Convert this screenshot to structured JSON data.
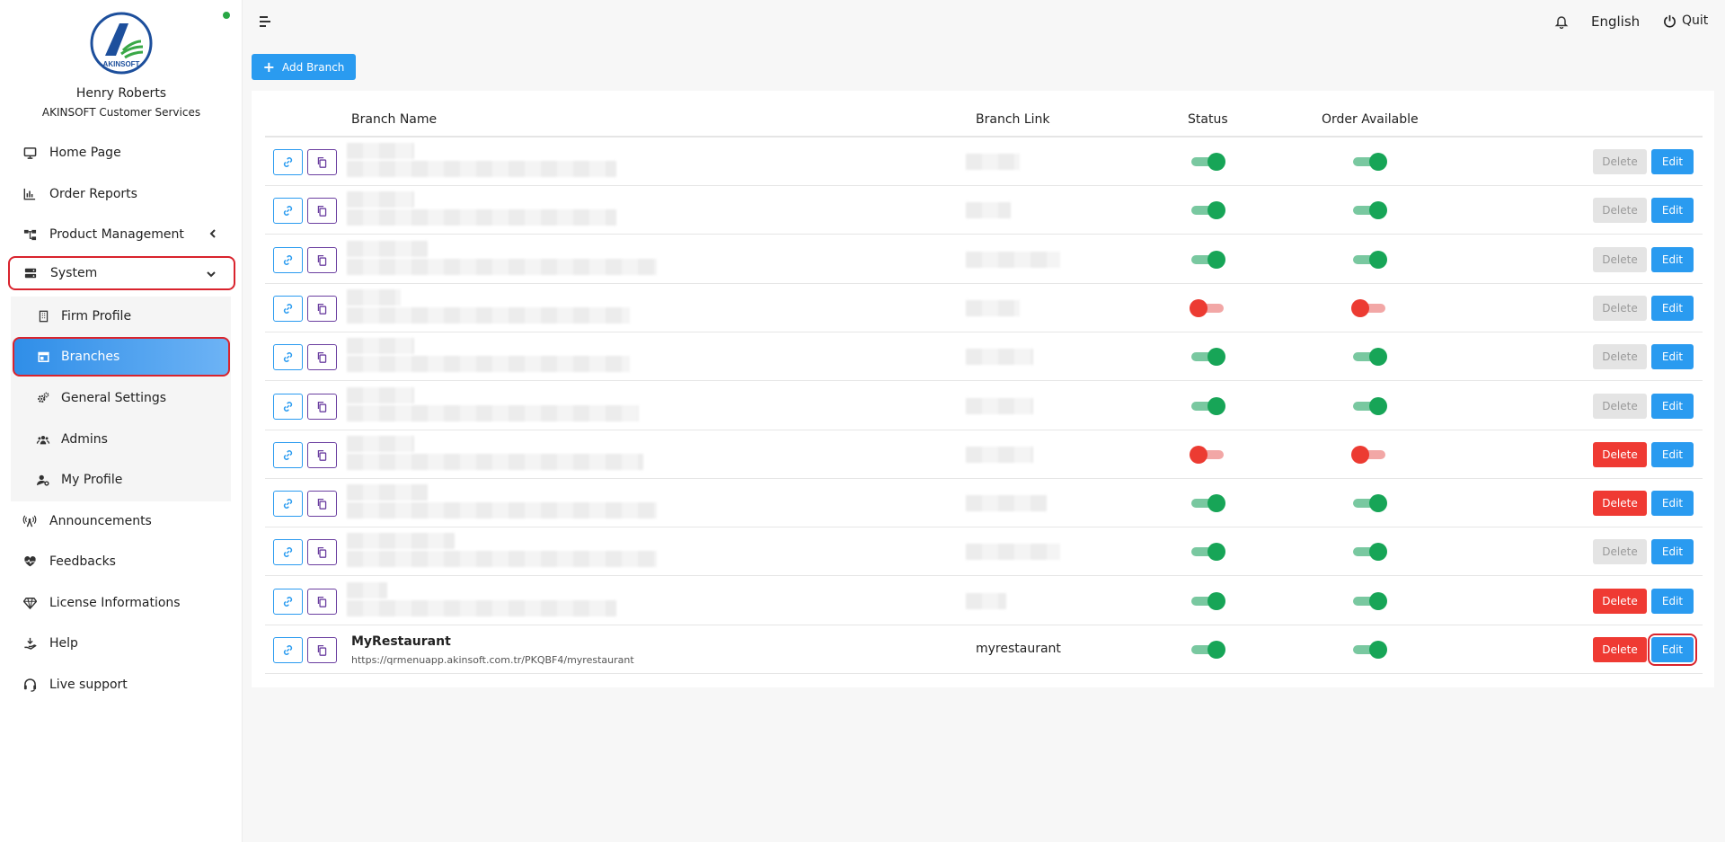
{
  "app": {
    "logo_text": "AKINSOFT"
  },
  "user": {
    "name": "Henry Roberts",
    "role": "AKINSOFT Customer Services"
  },
  "sidebar": {
    "items": [
      {
        "label": "Home Page",
        "icon": "monitor-icon"
      },
      {
        "label": "Order Reports",
        "icon": "bar-chart-icon"
      },
      {
        "label": "Product Management",
        "icon": "sitemap-icon"
      },
      {
        "label": "System",
        "icon": "server-icon"
      },
      {
        "label": "Announcements",
        "icon": "broadcast-icon"
      },
      {
        "label": "Feedbacks",
        "icon": "heart-pulse-icon"
      },
      {
        "label": "License Informations",
        "icon": "gem-icon"
      },
      {
        "label": "Help",
        "icon": "hand-holding-icon"
      },
      {
        "label": "Live support",
        "icon": "headset-icon"
      }
    ],
    "system_submenu": [
      {
        "label": "Firm Profile",
        "icon": "building-icon"
      },
      {
        "label": "Branches",
        "icon": "store-icon"
      },
      {
        "label": "General Settings",
        "icon": "gears-icon"
      },
      {
        "label": "Admins",
        "icon": "users-icon"
      },
      {
        "label": "My Profile",
        "icon": "user-gear-icon"
      }
    ]
  },
  "topbar": {
    "language": "English",
    "quit_label": "Quit"
  },
  "toolbar": {
    "add_branch_label": "Add Branch"
  },
  "table": {
    "columns": [
      "Branch Name",
      "Branch Link",
      "Status",
      "Order Available"
    ],
    "delete_label": "Delete",
    "edit_label": "Edit",
    "rows": [
      {
        "name": "",
        "url": "",
        "link": "",
        "status": true,
        "order_available": true,
        "delete_enabled": false
      },
      {
        "name": "",
        "url": "",
        "link": "",
        "status": true,
        "order_available": true,
        "delete_enabled": false
      },
      {
        "name": "",
        "url": "",
        "link": "",
        "status": true,
        "order_available": true,
        "delete_enabled": false
      },
      {
        "name": "",
        "url": "",
        "link": "",
        "status": false,
        "order_available": false,
        "delete_enabled": false
      },
      {
        "name": "",
        "url": "",
        "link": "",
        "status": true,
        "order_available": true,
        "delete_enabled": false
      },
      {
        "name": "",
        "url": "",
        "link": "",
        "status": true,
        "order_available": true,
        "delete_enabled": false
      },
      {
        "name": "",
        "url": "",
        "link": "",
        "status": false,
        "order_available": false,
        "delete_enabled": true
      },
      {
        "name": "",
        "url": "",
        "link": "",
        "status": true,
        "order_available": true,
        "delete_enabled": true
      },
      {
        "name": "",
        "url": "",
        "link": "",
        "status": true,
        "order_available": true,
        "delete_enabled": false
      },
      {
        "name": "",
        "url": "",
        "link": "",
        "status": true,
        "order_available": true,
        "delete_enabled": true
      },
      {
        "name": "MyRestaurant",
        "url": "https://qrmenuapp.akinsoft.com.tr/PKQBF4/myrestaurant",
        "link": "myrestaurant",
        "status": true,
        "order_available": true,
        "delete_enabled": true
      }
    ]
  },
  "colors": {
    "primary": "#2a9bf0",
    "danger": "#ef3a33",
    "success": "#17a557",
    "highlight": "#d9232d"
  }
}
